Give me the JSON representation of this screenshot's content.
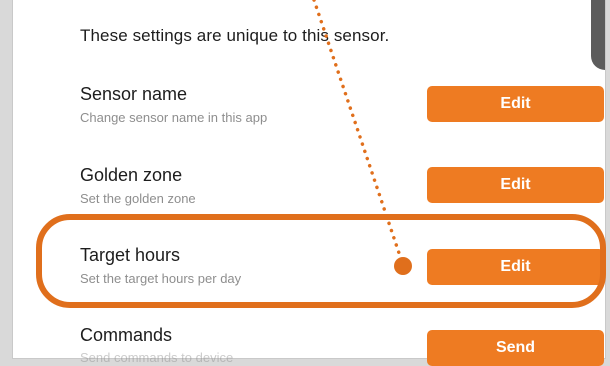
{
  "intro_text": "These settings are unique to this sensor.",
  "rows": [
    {
      "title": "Sensor name",
      "subtitle": "Change sensor name in this app",
      "button": "Edit"
    },
    {
      "title": "Golden zone",
      "subtitle": "Set the golden zone",
      "button": "Edit"
    },
    {
      "title": "Target hours",
      "subtitle": "Set the target hours per day",
      "button": "Edit"
    },
    {
      "title": "Commands",
      "subtitle": "Send commands to device",
      "button": "Send"
    }
  ],
  "colors": {
    "button": "#ee7b22",
    "highlight": "#e06f1c",
    "annotation": "#e06f1c"
  }
}
